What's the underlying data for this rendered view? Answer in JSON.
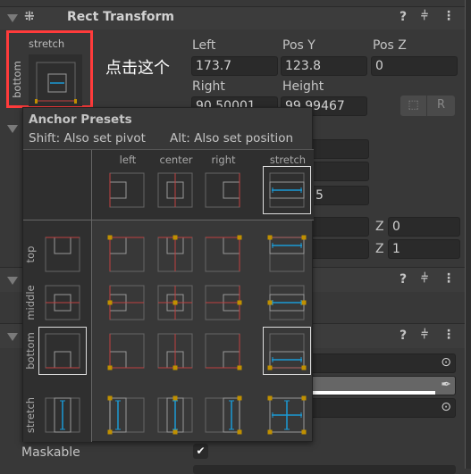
{
  "component": {
    "title": "Rect Transform",
    "collapse_icon": "triangle-down-icon",
    "component_icon": "rect-transform-icon",
    "help_icon": "question-icon",
    "preset_icon": "sliders-icon",
    "menu_icon": "kebab-icon"
  },
  "anchor_widget": {
    "horizontal": "stretch",
    "vertical": "bottom"
  },
  "annotation": "点击这个",
  "fields": {
    "left": {
      "label": "Left",
      "value": "173.7"
    },
    "pos_y": {
      "label": "Pos Y",
      "value": "123.8"
    },
    "pos_z": {
      "label": "Pos Z",
      "value": "0"
    },
    "right": {
      "label": "Right",
      "value": "90.50001"
    },
    "height": {
      "label": "Height",
      "value": "99.99467"
    },
    "partial_value": "5",
    "z1": {
      "label": "Z",
      "value": "0"
    },
    "z2": {
      "label": "Z",
      "value": "1"
    }
  },
  "buttons": {
    "blueprint_icon": "dashed-square-icon",
    "raw_label": "R"
  },
  "popup": {
    "title": "Anchor Presets",
    "hint_shift": "Shift: Also set pivot",
    "hint_alt": "Alt: Also set position",
    "columns": [
      "left",
      "center",
      "right",
      "stretch"
    ],
    "rows": [
      "top",
      "middle",
      "bottom",
      "stretch"
    ],
    "selected": {
      "horizontal": "stretch",
      "vertical": "bottom"
    }
  },
  "maskable": {
    "label": "Maskable",
    "checked": true
  },
  "colors": {
    "accent_red": "#ff3b3b",
    "anchor_line": "#c04040",
    "anchor_dot": "#c09000",
    "stretch_arrow": "#1a9ad6"
  }
}
